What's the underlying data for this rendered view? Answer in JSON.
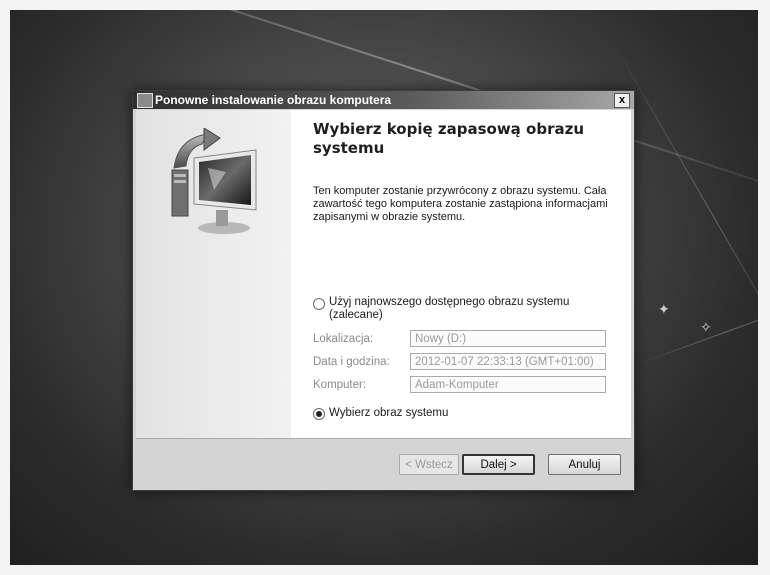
{
  "dialog": {
    "title": "Ponowne instalowanie obrazu komputera",
    "close": "x"
  },
  "content": {
    "heading": "Wybierz kopię zapasową obrazu systemu",
    "description": "Ten komputer zostanie przywrócony z obrazu systemu. Cała zawartość tego komputera zostanie zastąpiona informacjami zapisanymi w obrazie systemu.",
    "option_latest_line1": "Użyj najnowszego dostępnego obrazu systemu",
    "option_latest_line2": "(zalecane)",
    "option_choose": "Wybierz obraz systemu",
    "selected_option": "choose"
  },
  "fields": {
    "location_label": "Lokalizacja:",
    "location_value": "Nowy (D:)",
    "datetime_label": "Data i godzina:",
    "datetime_value": "2012-01-07 22:33:13 (GMT+01:00)",
    "computer_label": "Komputer:",
    "computer_value": "Adam-Komputer"
  },
  "buttons": {
    "back": "< Wstecz",
    "next": "Dalej >",
    "cancel": "Anuluj"
  },
  "icons": {
    "window": "backup-window-icon",
    "wizard": "monitor-backup-icon"
  }
}
